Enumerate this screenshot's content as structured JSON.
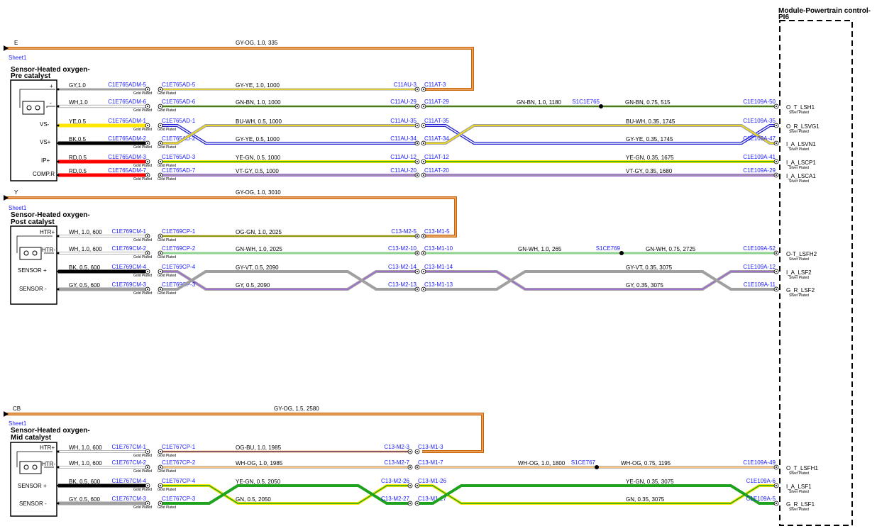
{
  "module": {
    "title_line1": "Module-Powertrain control-",
    "title_line2": "PI6"
  },
  "plating": {
    "gold": "Gold Plated",
    "silver": "Silver Plated"
  },
  "colors": {
    "GY": "#a0a0a0",
    "WH": "#ffffff",
    "YE": "#ffe600",
    "BK": "#000000",
    "RD": "#ff0000",
    "OG": "#f08c00",
    "BN": "#8b4513",
    "GN": "#1fa31f",
    "BU": "#1f1fd0",
    "VT": "#a064d8",
    "GYOG_border": "#c86400",
    "GYOG_fill": "#e8a060"
  },
  "sections": [
    {
      "id": "pre",
      "sheet_tag": "E",
      "sheet_link": "Sheet1",
      "supply_label": "GY-OG,  1.0,  335",
      "sensor_title1": "Sensor-Heated oxygen-",
      "sensor_title2": "Pre catalyst",
      "pins": [
        "+",
        "-",
        "VS-",
        "VS+",
        "IP+",
        "COMP.R"
      ],
      "wires": [
        {
          "spec": "GY,1.0",
          "cm": "C1E765ADM-5",
          "cp": "C1E765AD-5",
          "mid": "GY-YE,  1.0,  1000",
          "jl": "C11AU-3",
          "jr": "C11AT-3",
          "right": "",
          "splice": "",
          "right2": "",
          "pc": "",
          "sig": ""
        },
        {
          "spec": "WH,1.0",
          "cm": "C1E765ADM-6",
          "cp": "C1E765AD-6",
          "mid": "GN-BN,  1.0,  1000",
          "jl": "C11AU-29",
          "jr": "C11AT-29",
          "right": "GN-BN,  1.0,  1180",
          "splice": "S1C1E765",
          "right2": "GN-BN,  0.75,  515",
          "pc": "C1E109A-50",
          "sig": "O_T_LSH1"
        },
        {
          "spec": "YE,0.5",
          "cm": "C1E765ADM-1",
          "cp": "C1E765AD-1",
          "mid": "BU-WH,  0.5,  1000",
          "jl": "C11AU-35",
          "jr": "C11AT-35",
          "right": "",
          "splice": "",
          "right2": "BU-WH,  0.35,  1745",
          "pc": "C1E109A-35",
          "sig": "O_R_LSVG1"
        },
        {
          "spec": "BK,0.5",
          "cm": "C1E765ADM-2",
          "cp": "C1E765AD-2",
          "mid": "GY-YE,  0.5,  1000",
          "jl": "C11AU-34",
          "jr": "C11AT-34",
          "right": "",
          "splice": "",
          "right2": "GY-YE,  0.35,  1745",
          "pc": "C1E109A-47",
          "sig": "I_A_LSVN1"
        },
        {
          "spec": "RD,0.5",
          "cm": "C1E765ADM-3",
          "cp": "C1E765AD-3",
          "mid": "YE-GN,  0.5,  1000",
          "jl": "C11AU-12",
          "jr": "C11AT-12",
          "right": "",
          "splice": "",
          "right2": "YE-GN,  0.35,  1675",
          "pc": "C1E109A-41",
          "sig": "I_A_LSCP1"
        },
        {
          "spec": "RD,0.5",
          "cm": "C1E765ADM-7",
          "cp": "C1E765AD-7",
          "mid": "VT-GY,  0.5,  1000",
          "jl": "C11AU-20",
          "jr": "C11AT-20",
          "right": "",
          "splice": "",
          "right2": "VT-GY,  0.35,  1680",
          "pc": "C1E109A-29",
          "sig": "I_A_LSCA1"
        }
      ]
    },
    {
      "id": "post",
      "sheet_tag": "Y",
      "sheet_link": "Sheet1",
      "supply_label": "GY-OG,  1.0,  3010",
      "sensor_title1": "Sensor-Heated oxygen-",
      "sensor_title2": "Post catalyst",
      "pins": [
        "HTR+",
        "HTR-",
        "SENSOR +",
        "SENSOR -"
      ],
      "wires": [
        {
          "spec": "WH,  1.0,  600",
          "cm": "C1E769CM-1",
          "cp": "C1E769CP-1",
          "mid": "OG-GN,  1.0,  2025",
          "jl": "C13-M2-5",
          "jr": "C13-M1-5",
          "right": "",
          "splice": "",
          "right2": "",
          "pc": "",
          "sig": ""
        },
        {
          "spec": "WH,  1.0,  600",
          "cm": "C1E769CM-2",
          "cp": "C1E769CP-2",
          "mid": "GN-WH,  1.0,  2025",
          "jl": "C13-M2-10",
          "jr": "C13-M1-10",
          "right": "GN-WH,  1.0,  265",
          "splice": "S1CE769",
          "right2": "GN-WH,  0.75,  2725",
          "pc": "C1E109A-52",
          "sig": "O-T_LSFH2"
        },
        {
          "spec": "BK,  0.5,  600",
          "cm": "C1E769CM-4",
          "cp": "C1E769CP-4",
          "mid": "GY-VT,  0.5,  2090",
          "jl": "C13-M2-14",
          "jr": "C13-M1-14",
          "right": "",
          "splice": "",
          "right2": "GY-VT,  0.35,  3075",
          "pc": "C1E109A-12",
          "sig": "I_A_LSF2"
        },
        {
          "spec": "GY,  0.5,  600",
          "cm": "C1E769CM-3",
          "cp": "C1E769CP-3",
          "mid": "GY,  0.5,  2090",
          "jl": "C13-M2-13",
          "jr": "C13-M1-13",
          "right": "",
          "splice": "",
          "right2": "GY,  0.35,  3075",
          "pc": "C1E109A-11",
          "sig": "G_R_LSF2"
        }
      ]
    },
    {
      "id": "mid",
      "sheet_tag": "CB",
      "sheet_link": "Sheet1",
      "supply_label": "GY-OG,  1.5,  2580",
      "sensor_title1": "Sensor-Heated oxygen-",
      "sensor_title2": "Mid catalyst",
      "pins": [
        "HTR+",
        "HTR-",
        "SENSOR +",
        "SENSOR -"
      ],
      "wires": [
        {
          "spec": "WH,  1.0,  600",
          "cm": "C1E767CM-1",
          "cp": "C1E767CP-1",
          "mid": "OG-BU,  1.0,  1985",
          "jl": "C13-M2-3",
          "jr": "C13-M1-3",
          "right": "",
          "splice": "",
          "right2": "",
          "pc": "",
          "sig": ""
        },
        {
          "spec": "WH,  1.0,  600",
          "cm": "C1E767CM-2",
          "cp": "C1E767CP-2",
          "mid": "WH-OG,  1.0,  1985",
          "jl": "C13-M2-7",
          "jr": "C13-M1-7",
          "right": "WH-OG,  1.0,  1800",
          "splice": "S1CE767",
          "right2": "WH-OG,  0.75,  1195",
          "pc": "C1E109A-49",
          "sig": "O_T_LSFH1"
        },
        {
          "spec": "BK,  0.5,  600",
          "cm": "C1E767CM-4",
          "cp": "C1E767CP-4",
          "mid": "YE-GN,  0.5,  2050",
          "jl": "C13-M2-26",
          "jr": "C13-M1-26",
          "right": "",
          "splice": "",
          "right2": "YE-GN,  0.35,  3075",
          "pc": "C1E109A-6",
          "sig": "I_A_LSF1"
        },
        {
          "spec": "GY,  0.5,  600",
          "cm": "C1E767CM-3",
          "cp": "C1E767CP-3",
          "mid": "GN,  0.5,  2050",
          "jl": "C13-M2-27",
          "jr": "C13-M1-27",
          "right": "",
          "splice": "",
          "right2": "GN,  0.35,  3075",
          "pc": "C1E109A-5",
          "sig": "G_R_LSF1"
        }
      ]
    }
  ]
}
